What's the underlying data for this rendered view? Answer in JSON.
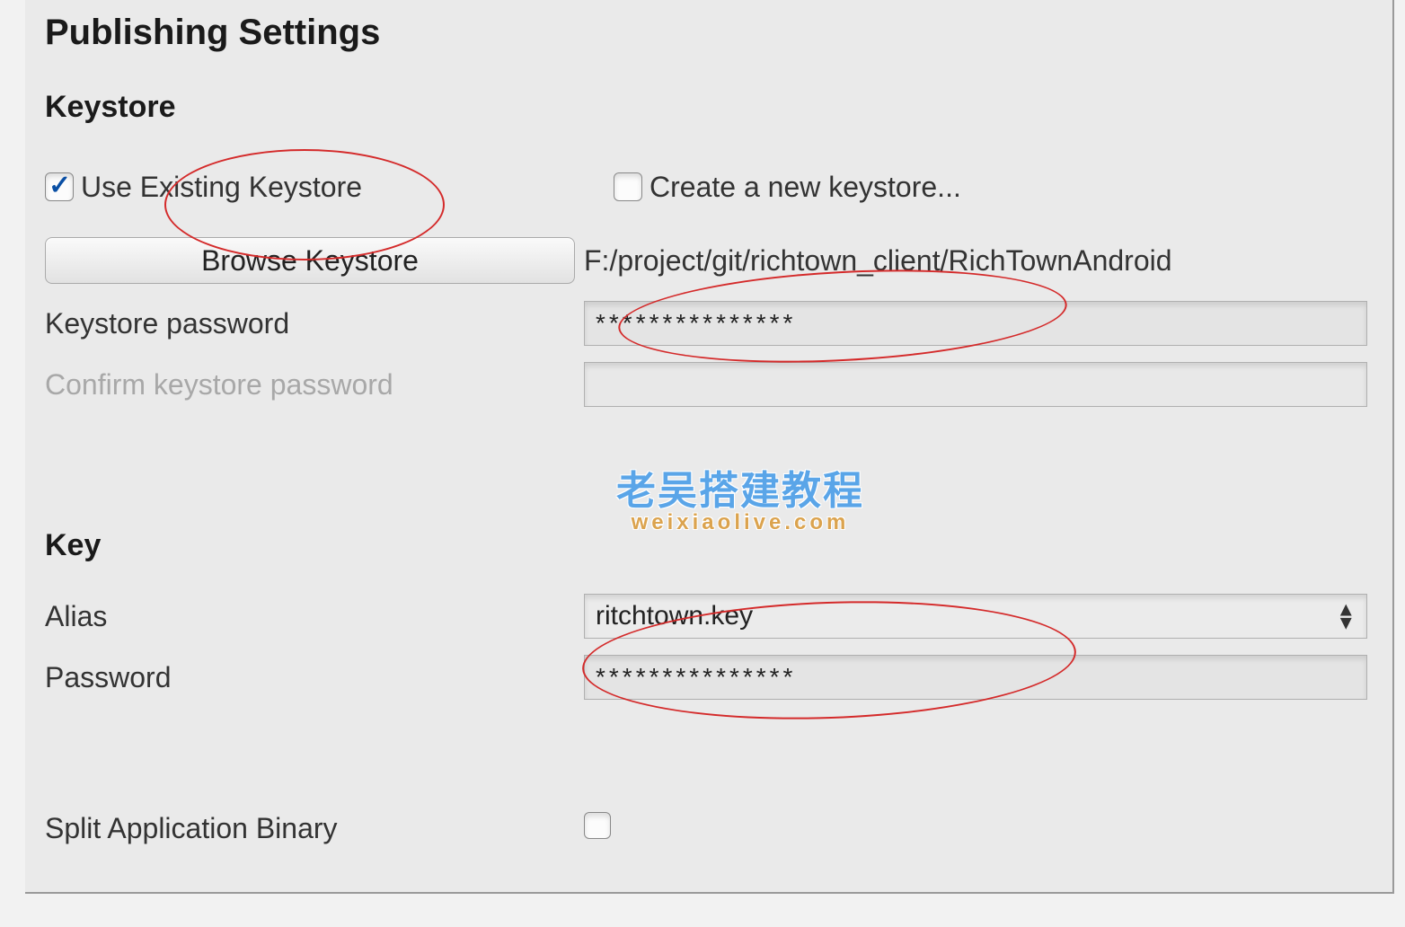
{
  "title": "Publishing Settings",
  "sections": {
    "keystore": {
      "heading": "Keystore",
      "use_existing": {
        "label": "Use Existing Keystore",
        "checked": true
      },
      "create_new": {
        "label": "Create a new keystore...",
        "checked": false
      },
      "browse_button": "Browse Keystore",
      "path": "F:/project/git/richtown_client/RichTownAndroid",
      "password_label": "Keystore password",
      "password_value": "***************",
      "confirm_label": "Confirm keystore password",
      "confirm_value": ""
    },
    "key": {
      "heading": "Key",
      "alias_label": "Alias",
      "alias_value": "ritchtown.key",
      "password_label": "Password",
      "password_value": "***************"
    },
    "split_binary": {
      "label": "Split Application Binary",
      "checked": false
    }
  },
  "watermark": {
    "line1": "老吴搭建教程",
    "line2": "weixiaolive.com"
  }
}
